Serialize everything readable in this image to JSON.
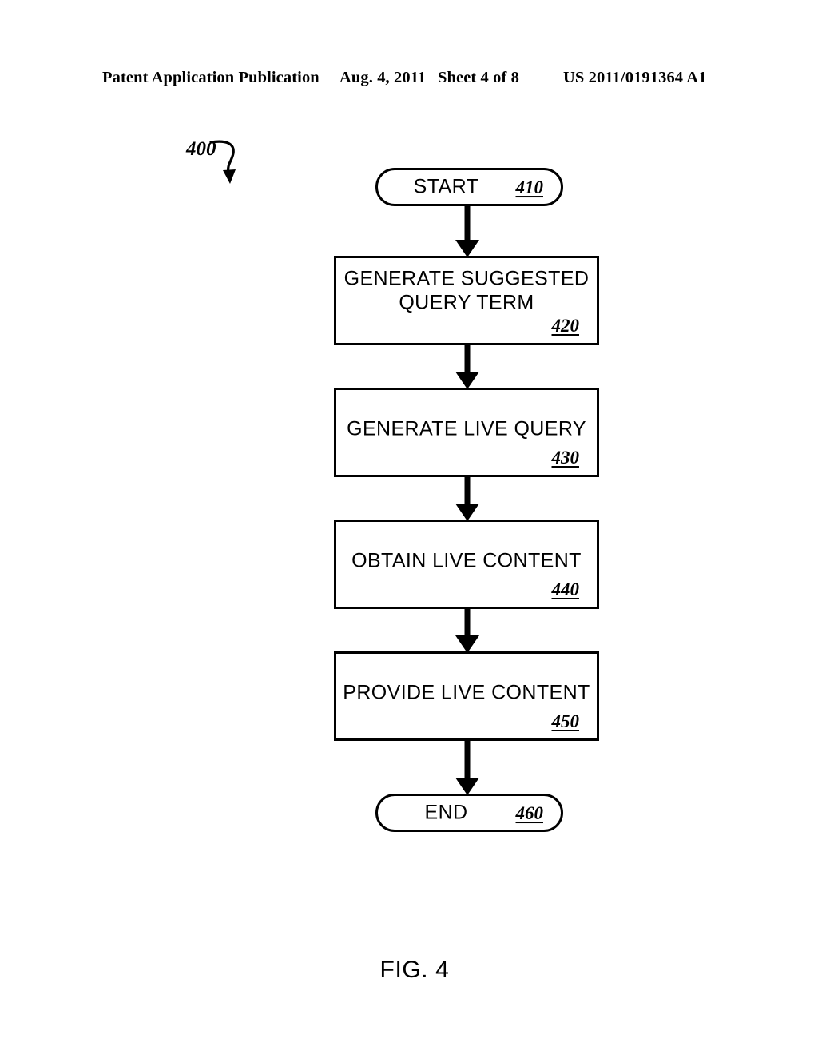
{
  "header": {
    "publication": "Patent Application Publication",
    "date": "Aug. 4, 2011",
    "sheet": "Sheet 4 of 8",
    "patent_number": "US 2011/0191364 A1"
  },
  "figure": {
    "reference_numeral": "400",
    "caption": "FIG. 4",
    "lead_arrow_icon": "curved-arrow-icon"
  },
  "diagram_data": {
    "type": "flowchart",
    "title": "FIG. 4",
    "orientation": "top-to-bottom",
    "nodes": [
      {
        "id": "410",
        "shape": "terminator",
        "label": "START",
        "ref": "410"
      },
      {
        "id": "420",
        "shape": "process",
        "label": "GENERATE SUGGESTED\nQUERY TERM",
        "ref": "420"
      },
      {
        "id": "430",
        "shape": "process",
        "label": "GENERATE LIVE QUERY",
        "ref": "430"
      },
      {
        "id": "440",
        "shape": "process",
        "label": "OBTAIN LIVE CONTENT",
        "ref": "440"
      },
      {
        "id": "450",
        "shape": "process",
        "label": "PROVIDE LIVE CONTENT",
        "ref": "450"
      },
      {
        "id": "460",
        "shape": "terminator",
        "label": "END",
        "ref": "460"
      }
    ],
    "edges": [
      {
        "from": "410",
        "to": "420",
        "style": "solid-arrow"
      },
      {
        "from": "420",
        "to": "430",
        "style": "solid-arrow"
      },
      {
        "from": "430",
        "to": "440",
        "style": "solid-arrow"
      },
      {
        "from": "440",
        "to": "450",
        "style": "solid-arrow"
      },
      {
        "from": "450",
        "to": "460",
        "style": "solid-arrow"
      }
    ],
    "colors": {
      "stroke": "#000000",
      "fill": "#ffffff",
      "text": "#000000",
      "background": "#ffffff"
    }
  }
}
